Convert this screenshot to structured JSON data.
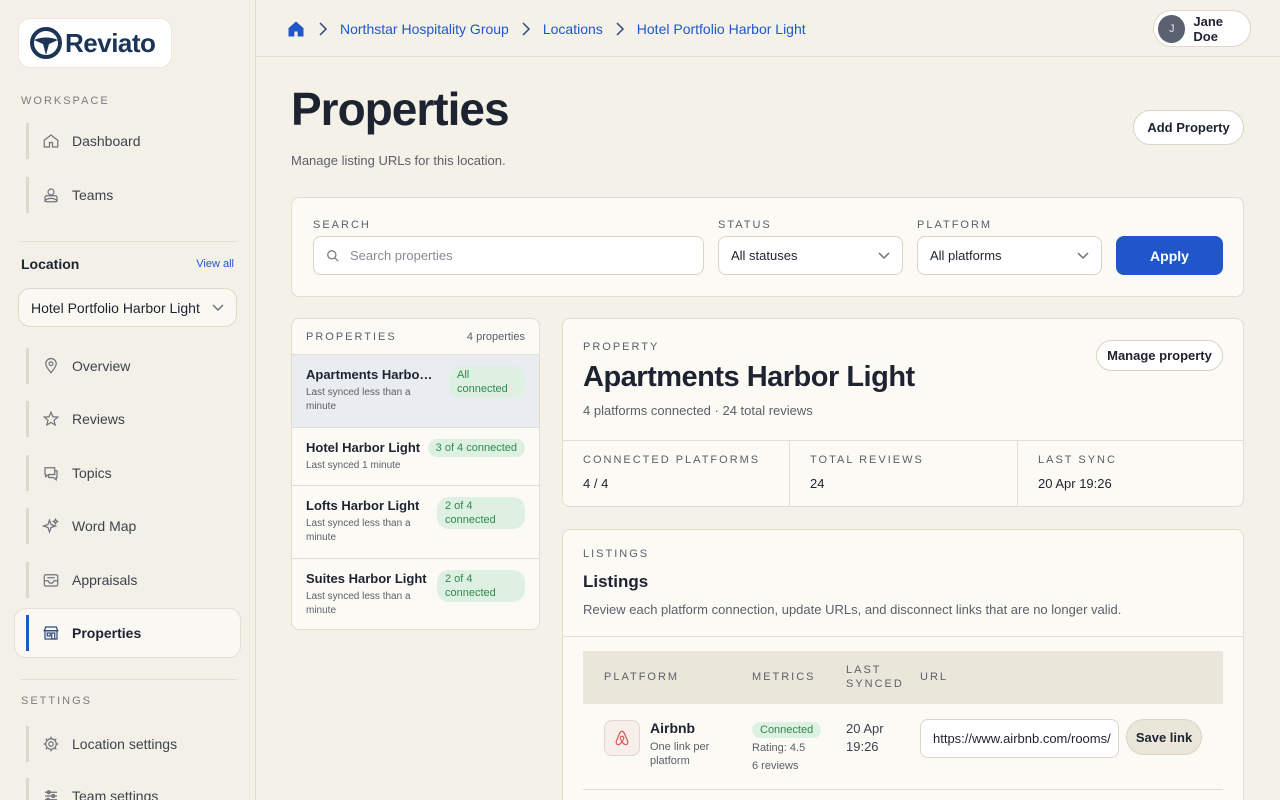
{
  "brand": {
    "name": "Reviato"
  },
  "sidebar": {
    "workspace_label": "WORKSPACE",
    "workspace_items": [
      {
        "label": "Dashboard",
        "icon": "home-icon"
      },
      {
        "label": "Teams",
        "icon": "users-icon"
      }
    ],
    "location_title": "Location",
    "view_all": "View all",
    "location_selected": "Hotel Portfolio Harbor Light",
    "location_items": [
      {
        "label": "Overview",
        "icon": "map-pin-icon"
      },
      {
        "label": "Reviews",
        "icon": "star-icon"
      },
      {
        "label": "Topics",
        "icon": "chat-icon"
      },
      {
        "label": "Word Map",
        "icon": "sparkle-icon"
      },
      {
        "label": "Appraisals",
        "icon": "inbox-icon"
      },
      {
        "label": "Properties",
        "icon": "building-icon",
        "active": true
      }
    ],
    "settings_label": "SETTINGS",
    "settings_items": [
      {
        "label": "Location settings",
        "icon": "gear-icon"
      },
      {
        "label": "Team settings",
        "icon": "sliders-icon"
      }
    ]
  },
  "topbar": {
    "breadcrumbs": [
      "Northstar Hospitality Group",
      "Locations",
      "Hotel Portfolio Harbor Light"
    ],
    "user_name": "Jane Doe",
    "user_initial": "J"
  },
  "page": {
    "title": "Properties",
    "subtitle": "Manage listing URLs for this location.",
    "add_button": "Add Property"
  },
  "filters": {
    "search_label": "SEARCH",
    "search_placeholder": "Search properties",
    "status_label": "STATUS",
    "status_value": "All statuses",
    "platform_label": "PLATFORM",
    "platform_value": "All platforms",
    "apply": "Apply"
  },
  "properties_list": {
    "label": "PROPERTIES",
    "count": "4 properties",
    "items": [
      {
        "name": "Apartments Harbor Light",
        "sync": "Last synced less than a minute",
        "status": "All connected"
      },
      {
        "name": "Hotel Harbor Light",
        "sync": "Last synced 1 minute",
        "status": "3 of 4 connected"
      },
      {
        "name": "Lofts Harbor Light",
        "sync": "Last synced less than a minute",
        "status": "2 of 4 connected"
      },
      {
        "name": "Suites Harbor Light",
        "sync": "Last synced less than a minute",
        "status": "2 of 4 connected"
      }
    ]
  },
  "detail": {
    "eyebrow": "PROPERTY",
    "name": "Apartments Harbor Light",
    "summary": "4 platforms connected · 24 total reviews",
    "manage_button": "Manage property",
    "stats": [
      {
        "label": "CONNECTED PLATFORMS",
        "value": "4 / 4"
      },
      {
        "label": "TOTAL REVIEWS",
        "value": "24"
      },
      {
        "label": "LAST SYNC",
        "value": "20 Apr 19:26"
      }
    ]
  },
  "listings": {
    "eyebrow": "LISTINGS",
    "title": "Listings",
    "description": "Review each platform connection, update URLs, and disconnect links that are no longer valid.",
    "columns": [
      "PLATFORM",
      "METRICS",
      "LAST SYNCED",
      "URL"
    ],
    "rows": [
      {
        "platform": "Airbnb",
        "platform_note": "One link per platform",
        "status": "Connected",
        "rating": "Rating: 4.5",
        "reviews": "6 reviews",
        "last_synced": "20 Apr 19:26",
        "url": "https://www.airbnb.com/rooms/",
        "save": "Save link"
      }
    ]
  },
  "colors": {
    "accent": "#2056c9",
    "background": "#f4f1e8",
    "success": "#2f8a4e"
  }
}
